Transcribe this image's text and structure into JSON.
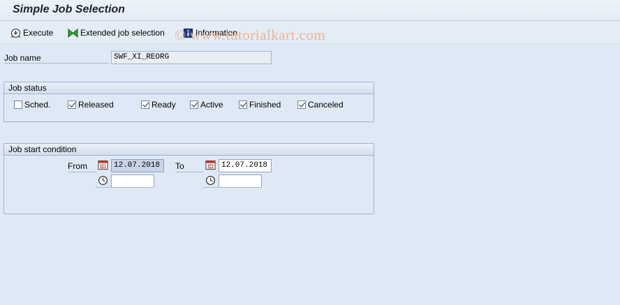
{
  "title": "Simple Job Selection",
  "toolbar": {
    "execute_label": "Execute",
    "extended_label": "Extended job selection",
    "information_label": "Information"
  },
  "watermark": "© www.tutorialkart.com",
  "job_name": {
    "label": "Job name",
    "value": "SWF_XI_REORG"
  },
  "job_status": {
    "header": "Job status",
    "options": [
      {
        "label": "Sched.",
        "checked": false
      },
      {
        "label": "Released",
        "checked": true
      },
      {
        "label": "Ready",
        "checked": true
      },
      {
        "label": "Active",
        "checked": true
      },
      {
        "label": "Finished",
        "checked": true
      },
      {
        "label": "Canceled",
        "checked": true
      }
    ]
  },
  "start_condition": {
    "header": "Job start condition",
    "from_label": "From",
    "to_label": "To",
    "from_date": "12.07.2018",
    "to_date": "12.07.2018",
    "from_time": "",
    "to_time": ""
  },
  "icons": {
    "execute": "execute-icon",
    "extended": "bowtie-icon",
    "information": "info-icon",
    "calendar": "calendar-icon",
    "clock": "clock-icon"
  }
}
